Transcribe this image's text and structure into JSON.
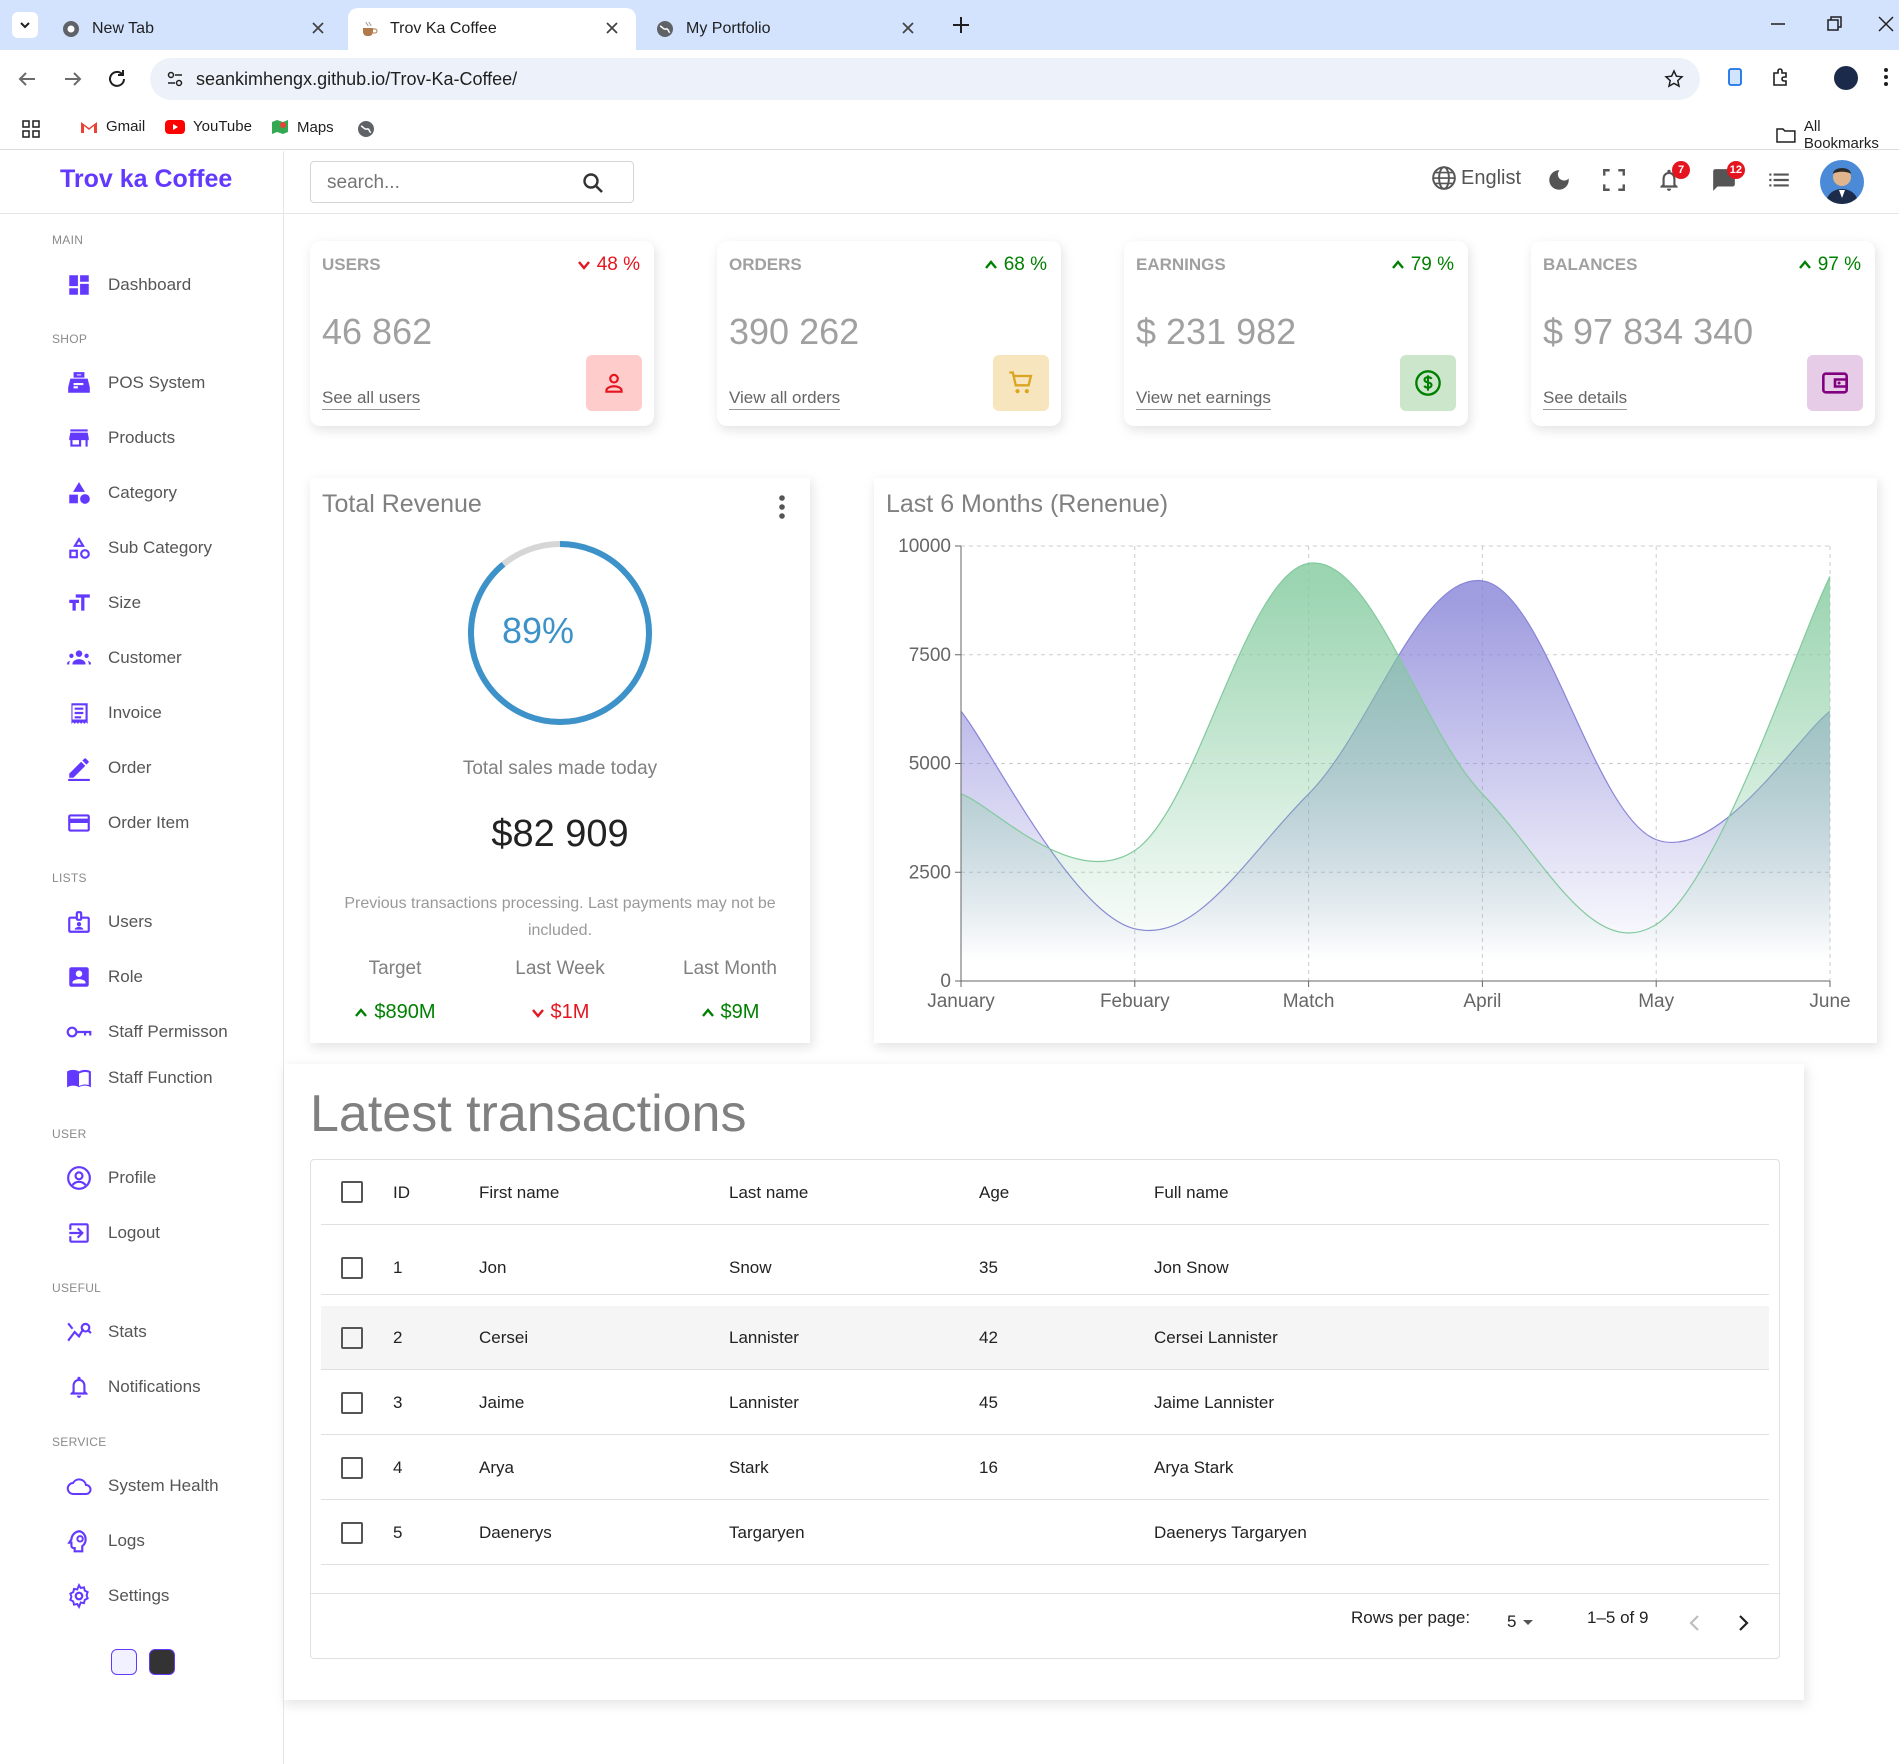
{
  "browser": {
    "tabs": [
      {
        "title": "New Tab"
      },
      {
        "title": "Trov Ka Coffee"
      },
      {
        "title": "My Portfolio"
      }
    ],
    "url": "seankimhengx.github.io/Trov-Ka-Coffee/",
    "bookmarks": [
      "Gmail",
      "YouTube",
      "Maps"
    ],
    "all_bookmarks": "All Bookmarks"
  },
  "app": {
    "logo": "Trov ka Coffee",
    "search_placeholder": "search...",
    "language": "Englist",
    "notifications_count": "7",
    "messages_count": "12"
  },
  "sidebar": {
    "sections": [
      {
        "title": "MAIN",
        "items": [
          {
            "label": "Dashboard",
            "icon": "dashboard-icon"
          }
        ]
      },
      {
        "title": "SHOP",
        "items": [
          {
            "label": "POS System",
            "icon": "pos-icon"
          },
          {
            "label": "Products",
            "icon": "store-icon"
          },
          {
            "label": "Category",
            "icon": "category-icon"
          },
          {
            "label": "Sub Category",
            "icon": "subcategory-icon"
          },
          {
            "label": "Size",
            "icon": "text-size-icon"
          },
          {
            "label": "Customer",
            "icon": "groups-icon"
          },
          {
            "label": "Invoice",
            "icon": "receipt-icon"
          },
          {
            "label": "Order",
            "icon": "edit-icon"
          },
          {
            "label": "Order Item",
            "icon": "credit-card-icon"
          }
        ]
      },
      {
        "title": "LISTS",
        "items": [
          {
            "label": "Users",
            "icon": "badge-icon"
          },
          {
            "label": "Role",
            "icon": "account-box-icon"
          },
          {
            "label": "Staff Permisson",
            "icon": "key-icon"
          },
          {
            "label": "Staff Function",
            "icon": "menu-book-icon"
          }
        ]
      },
      {
        "title": "USER",
        "items": [
          {
            "label": "Profile",
            "icon": "account-circle-icon"
          },
          {
            "label": "Logout",
            "icon": "logout-icon"
          }
        ]
      },
      {
        "title": "USEFUL",
        "items": [
          {
            "label": "Stats",
            "icon": "stats-icon"
          },
          {
            "label": "Notifications",
            "icon": "bell-icon"
          }
        ]
      },
      {
        "title": "SERVICE",
        "items": [
          {
            "label": "System Health",
            "icon": "cloud-icon"
          },
          {
            "label": "Logs",
            "icon": "psychology-icon"
          },
          {
            "label": "Settings",
            "icon": "settings-icon"
          }
        ]
      }
    ]
  },
  "widgets": [
    {
      "title": "USERS",
      "pct": "48 %",
      "trend": "down",
      "value": "46 862",
      "link": "See all users",
      "icon": "person-icon",
      "color": "#e4151f",
      "bg": "#ffcccc"
    },
    {
      "title": "ORDERS",
      "pct": "68 %",
      "trend": "up",
      "value": "390 262",
      "link": "View all orders",
      "icon": "cart-icon",
      "color": "#daa520",
      "bg": "#f6e5bd"
    },
    {
      "title": "EARNINGS",
      "pct": "79 %",
      "trend": "up",
      "value": "$ 231 982",
      "link": "View net earnings",
      "icon": "dollar-icon",
      "color": "#008000",
      "bg": "#cce6cc"
    },
    {
      "title": "BALANCES",
      "pct": "97 %",
      "trend": "up",
      "value": "$ 97 834 340",
      "link": "See details",
      "icon": "wallet-icon",
      "color": "#800080",
      "bg": "#e6cce6"
    }
  ],
  "revenue": {
    "title": "Total Revenue",
    "progress_pct": 89,
    "progress_label": "89%",
    "subtitle": "Total sales made today",
    "amount": "$82 909",
    "note": "Previous transactions processing. Last payments may not be included.",
    "items": [
      {
        "label": "Target",
        "value": "$890M",
        "trend": "up"
      },
      {
        "label": "Last Week",
        "value": "$1M",
        "trend": "down"
      },
      {
        "label": "Last Month",
        "value": "$9M",
        "trend": "up"
      }
    ]
  },
  "chart_data": {
    "type": "area",
    "title": "Last 6 Months (Renenue)",
    "categories": [
      "January",
      "Febuary",
      "Match",
      "April",
      "May",
      "June"
    ],
    "series": [
      {
        "color": "#8884d8",
        "values": [
          6200,
          1200,
          4300,
          9200,
          3250,
          6200
        ]
      },
      {
        "color": "#82ca9d",
        "values": [
          4300,
          3000,
          9600,
          4300,
          1300,
          9300
        ]
      }
    ],
    "ylim": [
      0,
      10000
    ],
    "yticks": [
      "0",
      "2500",
      "5000",
      "7500",
      "10000"
    ],
    "grid": true
  },
  "transactions": {
    "title": "Latest transactions",
    "columns": [
      "ID",
      "First name",
      "Last name",
      "Age",
      "Full name"
    ],
    "rows": [
      {
        "id": "1",
        "first": "Jon",
        "last": "Snow",
        "age": "35",
        "full": "Jon Snow"
      },
      {
        "id": "2",
        "first": "Cersei",
        "last": "Lannister",
        "age": "42",
        "full": "Cersei Lannister"
      },
      {
        "id": "3",
        "first": "Jaime",
        "last": "Lannister",
        "age": "45",
        "full": "Jaime Lannister"
      },
      {
        "id": "4",
        "first": "Arya",
        "last": "Stark",
        "age": "16",
        "full": "Arya Stark"
      },
      {
        "id": "5",
        "first": "Daenerys",
        "last": "Targaryen",
        "age": "",
        "full": "Daenerys Targaryen"
      }
    ],
    "rows_per_page_label": "Rows per page:",
    "rows_per_page": "5",
    "range": "1–5 of 9"
  }
}
